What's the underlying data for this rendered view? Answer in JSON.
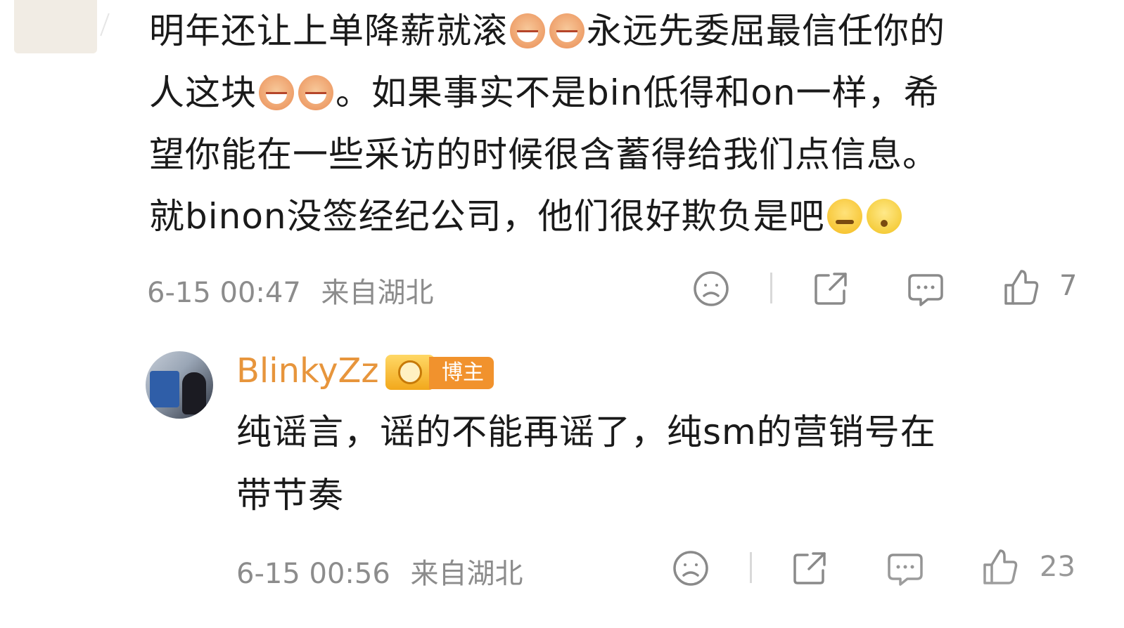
{
  "comment": {
    "text_line1a": "明年还让上单降薪就滚",
    "text_line1b": "永远先委屈最信任你的",
    "text_line2a": "人这块",
    "text_line2b": "。如果事实不是bin低得和on一样，希",
    "text_line3": "望你能在一些采访的时候很含蓄得给我们点信息。",
    "text_line4": "就binon没签经纪公司，他们很好欺负是吧",
    "emojis": [
      "laugh",
      "laugh",
      "laugh",
      "laugh",
      "smirk",
      "think"
    ],
    "time": "6-15 00:47",
    "location": "来自湖北",
    "like_count": "7"
  },
  "reply": {
    "username": "BlinkyZz",
    "badge": "博主",
    "text_line1": "纯谣言，谣的不能再谣了，纯sm的营销号在",
    "text_line2": "带节奏",
    "time": "6-15 00:56",
    "location": "来自湖北",
    "like_count": "23"
  },
  "icons": [
    "dislike-icon",
    "share-icon",
    "comment-icon",
    "like-icon"
  ],
  "colors": {
    "username": "#e7953c",
    "badge_bg": "#f1922d",
    "meta_text": "#8c8c8c",
    "body_text": "#1a1a1a"
  }
}
